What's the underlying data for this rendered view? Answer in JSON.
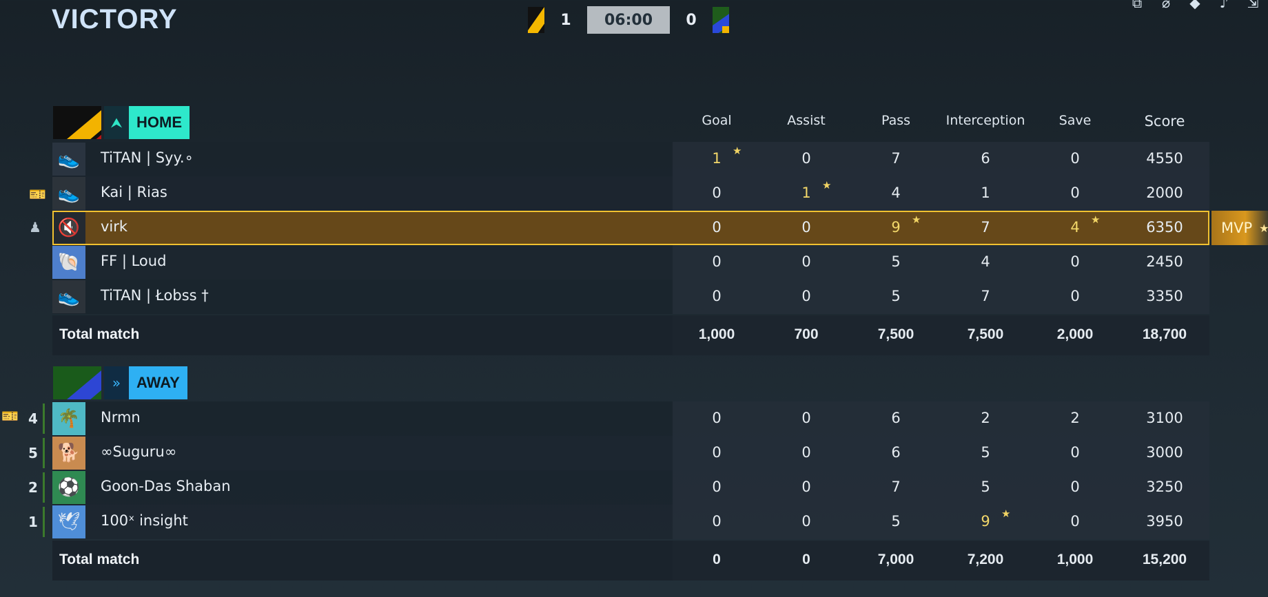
{
  "header": {
    "result": "VICTORY",
    "home_score": "1",
    "away_score": "0",
    "timer": "06:00"
  },
  "columns": [
    "Goal",
    "Assist",
    "Pass",
    "Interception",
    "Save",
    "Score"
  ],
  "home": {
    "label": "HOME",
    "players": [
      {
        "name": "TiTAN | Syy.∘",
        "stats": [
          "1",
          "0",
          "7",
          "6",
          "0",
          "4550"
        ],
        "best": [
          0
        ]
      },
      {
        "name": "Kai | Rias",
        "stats": [
          "0",
          "1",
          "4",
          "1",
          "0",
          "2000"
        ],
        "best": [
          1
        ]
      },
      {
        "name": "virk",
        "stats": [
          "0",
          "0",
          "9",
          "7",
          "4",
          "6350"
        ],
        "best": [
          2,
          4
        ],
        "mvp": true
      },
      {
        "name": "FF | Loud",
        "stats": [
          "0",
          "0",
          "5",
          "4",
          "0",
          "2450"
        ],
        "best": []
      },
      {
        "name": "TiTAN | Łobѕѕ †",
        "stats": [
          "0",
          "0",
          "5",
          "7",
          "0",
          "3350"
        ],
        "best": []
      }
    ],
    "total_label": "Total match",
    "totals": [
      "1,000",
      "700",
      "7,500",
      "7,500",
      "2,000",
      "18,700"
    ]
  },
  "away": {
    "label": "AWAY",
    "players": [
      {
        "rank": "4",
        "name": "Nrmn",
        "stats": [
          "0",
          "0",
          "6",
          "2",
          "2",
          "3100"
        ],
        "best": []
      },
      {
        "rank": "5",
        "name": "∞Suguru∞",
        "stats": [
          "0",
          "0",
          "6",
          "5",
          "0",
          "3000"
        ],
        "best": []
      },
      {
        "rank": "2",
        "name": "Goon-Das Shaban",
        "stats": [
          "0",
          "0",
          "7",
          "5",
          "0",
          "3250"
        ],
        "best": []
      },
      {
        "rank": "1",
        "name": "100ˣ insight",
        "stats": [
          "0",
          "0",
          "5",
          "9",
          "0",
          "3950"
        ],
        "best": [
          3
        ]
      }
    ],
    "total_label": "Total match",
    "totals": [
      "0",
      "0",
      "7,000",
      "7,200",
      "1,000",
      "15,200"
    ]
  },
  "mvp_label": "MVP",
  "icons": {
    "top": [
      "share-icon",
      "link-off-icon",
      "diamond-icon",
      "volume-icon",
      "exit-icon"
    ],
    "star": "star-icon"
  },
  "colors": {
    "home": "#2ee8cb",
    "away": "#2eb0f3",
    "highlight": "#f3d86a",
    "mvp_border": "#f2c230"
  }
}
